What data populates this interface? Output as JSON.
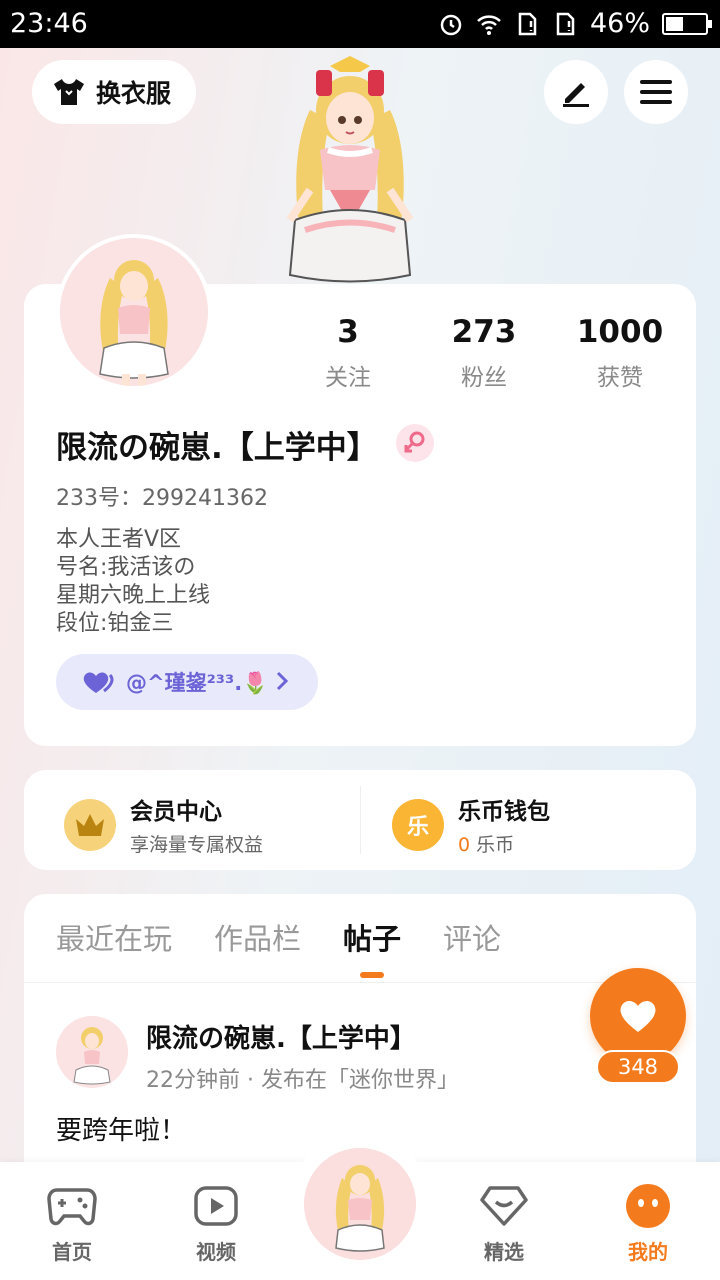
{
  "status_bar": {
    "time": "23:46",
    "battery": "46%",
    "battery_level": 0.46
  },
  "header": {
    "outfit_label": "换衣服"
  },
  "profile": {
    "username": "限流の碗崽.【上学中】",
    "uid": "233号：299241362",
    "bio": [
      "本人王者V区",
      "号名:我活该の",
      "星期六晚上上线",
      "段位:铂金三"
    ],
    "bond_text": "@^瑾鋆²³³.🌷",
    "stats": [
      {
        "value": "3",
        "label": "关注"
      },
      {
        "value": "273",
        "label": "粉丝"
      },
      {
        "value": "1000",
        "label": "获赞"
      }
    ]
  },
  "member": {
    "title": "会员中心",
    "subtitle": "享海量专属权益"
  },
  "wallet": {
    "title": "乐币钱包",
    "amount": "0",
    "unit": "乐币",
    "icon_char": "乐"
  },
  "tabs": [
    "最近在玩",
    "作品栏",
    "帖子",
    "评论"
  ],
  "active_tab": "帖子",
  "post": {
    "author": "限流の碗崽.【上学中】",
    "meta": "22分钟前 · 发布在「迷你世界」",
    "text": "要跨年啦！"
  },
  "like": {
    "count": "348"
  },
  "bottom_nav": [
    {
      "label": "首页",
      "icon": "gamepad-icon"
    },
    {
      "label": "视频",
      "icon": "play-icon"
    },
    {
      "label": "精选",
      "icon": "heart-badge-icon"
    },
    {
      "label": "我的",
      "icon": "face-icon",
      "active": true
    }
  ],
  "colors": {
    "accent": "#f47b1d",
    "bond": "#6b63d6",
    "card": "#ffffff"
  }
}
